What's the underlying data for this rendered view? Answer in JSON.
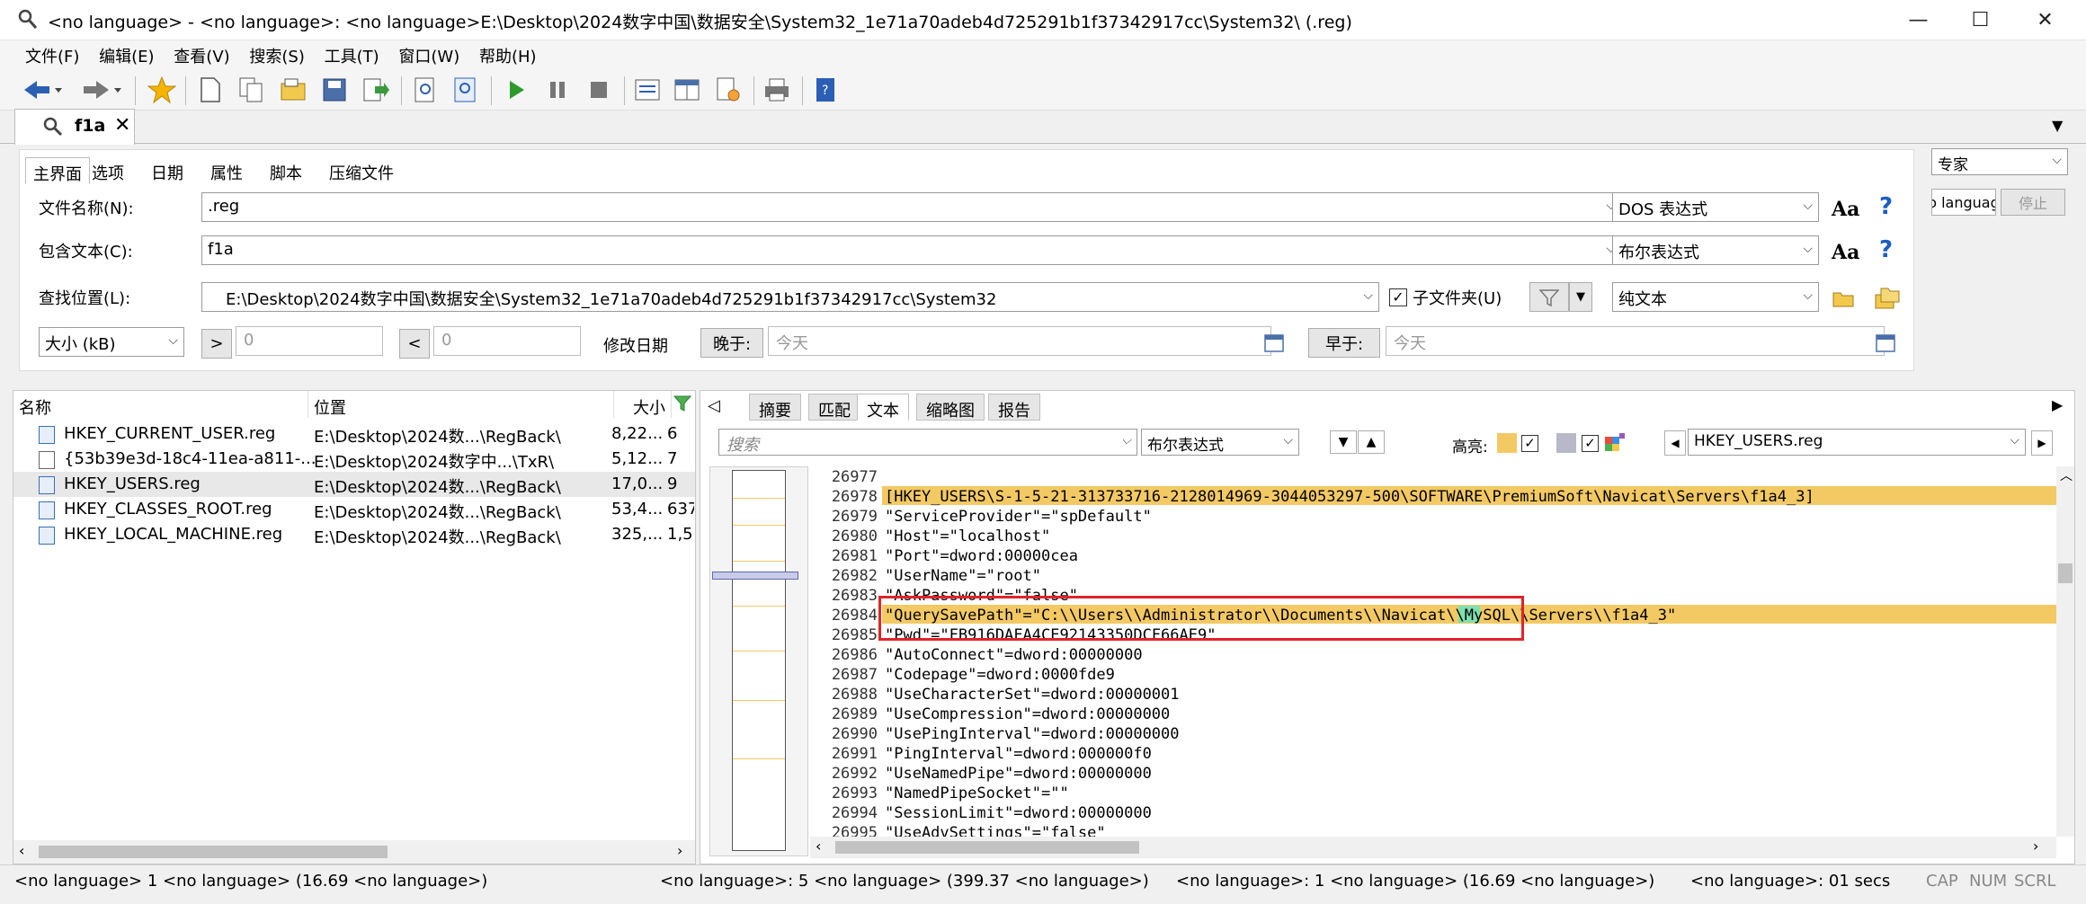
{
  "window": {
    "title": "<no language> - <no language>: <no language>E:\\Desktop\\2024数字中国\\数据安全\\System32_1e71a70adeb4d725291b1f37342917cc\\System32\\ (.reg)"
  },
  "menu": [
    "文件(F)",
    "编辑(E)",
    "查看(V)",
    "搜索(S)",
    "工具(T)",
    "窗口(W)",
    "帮助(H)"
  ],
  "tab": {
    "label": "f1a"
  },
  "panel_tabs": [
    "主界面",
    "选项",
    "日期",
    "属性",
    "脚本",
    "压缩文件"
  ],
  "search": {
    "filename_label": "文件名称(N):",
    "filename_value": ".reg",
    "filename_mode": "DOS 表达式",
    "contains_label": "包含文本(C):",
    "contains_value": "f1a",
    "contains_mode": "布尔表达式",
    "location_label": "查找位置(L):",
    "location_value": "E:\\Desktop\\2024数字中国\\数据安全\\System32_1e71a70adeb4d725291b1f37342917cc\\System32",
    "subfolders_label": "子文件夹(U)",
    "location_mode": "纯文本",
    "size_unit": "大小 (kB)",
    "gt": ">",
    "lt": "<",
    "size_min": "0",
    "size_max": "0",
    "date_label": "修改日期",
    "later_btn": "晚于:",
    "later_value": "今天",
    "earlier_btn": "早于:",
    "earlier_value": "今天"
  },
  "side": {
    "mode": "专家",
    "lang_btn": "o languag",
    "stop_btn": "停止"
  },
  "results": {
    "headers": [
      "名称",
      "位置",
      "大小"
    ],
    "rows": [
      {
        "name": "HKEY_CURRENT_USER.reg",
        "location": "E:\\Desktop\\2024数...\\RegBack\\",
        "size": "8,22...",
        "hits": "6"
      },
      {
        "name": "{53b39e3d-18c4-11ea-a811-...",
        "location": "E:\\Desktop\\2024数字中...\\TxR\\",
        "size": "5,12...",
        "hits": "7"
      },
      {
        "name": "HKEY_USERS.reg",
        "location": "E:\\Desktop\\2024数...\\RegBack\\",
        "size": "17,0...",
        "hits": "9"
      },
      {
        "name": "HKEY_CLASSES_ROOT.reg",
        "location": "E:\\Desktop\\2024数...\\RegBack\\",
        "size": "53,4...",
        "hits": "637"
      },
      {
        "name": "HKEY_LOCAL_MACHINE.reg",
        "location": "E:\\Desktop\\2024数...\\RegBack\\",
        "size": "325,...",
        "hits": "1,5..."
      }
    ]
  },
  "preview": {
    "tabs": [
      "摘要",
      "匹配",
      "文本",
      "缩略图",
      "报告"
    ],
    "search_placeholder": "搜索",
    "mode": "布尔表达式",
    "highlight_label": "高亮:",
    "file": "HKEY_USERS.reg",
    "lines": [
      {
        "n": "26977",
        "t": ""
      },
      {
        "n": "26978",
        "t": "[HKEY_USERS\\S-1-5-21-313733716-2128014969-3044053297-500\\SOFTWARE\\PremiumSoft\\Navicat\\Servers\\f1a4_3]"
      },
      {
        "n": "26979",
        "t": "\"ServiceProvider\"=\"spDefault\""
      },
      {
        "n": "26980",
        "t": "\"Host\"=\"localhost\""
      },
      {
        "n": "26981",
        "t": "\"Port\"=dword:00000cea"
      },
      {
        "n": "26982",
        "t": "\"UserName\"=\"root\""
      },
      {
        "n": "26983",
        "t": "\"AskPassword\"=\"false\""
      },
      {
        "n": "26984",
        "t": "\"QuerySavePath\"=\"C:\\\\Users\\\\Administrator\\\\Documents\\\\Navicat\\\\MySQL\\\\Servers\\\\f1a4_3\""
      },
      {
        "n": "26985",
        "t": "\"Pwd\"=\"FB916DAFA4CE92143350DCF66AE9\""
      },
      {
        "n": "26986",
        "t": "\"AutoConnect\"=dword:00000000"
      },
      {
        "n": "26987",
        "t": "\"Codepage\"=dword:0000fde9"
      },
      {
        "n": "26988",
        "t": "\"UseCharacterSet\"=dword:00000001"
      },
      {
        "n": "26989",
        "t": "\"UseCompression\"=dword:00000000"
      },
      {
        "n": "26990",
        "t": "\"UsePingInterval\"=dword:00000000"
      },
      {
        "n": "26991",
        "t": "\"PingInterval\"=dword:000000f0"
      },
      {
        "n": "26992",
        "t": "\"UseNamedPipe\"=dword:00000000"
      },
      {
        "n": "26993",
        "t": "\"NamedPipeSocket\"=\"\""
      },
      {
        "n": "26994",
        "t": "\"SessionLimit\"=dword:00000000"
      },
      {
        "n": "26995",
        "t": "\"UseAdvSettings\"=\"false\""
      }
    ]
  },
  "status": {
    "s1": "<no language> 1 <no language> (16.69 <no language>)",
    "s2": "<no language>: 5 <no language> (399.37 <no language>)",
    "s3": "<no language>: 1 <no language> (16.69 <no language>)",
    "s4": "<no language>: 01 secs",
    "caps": "CAP",
    "num": "NUM",
    "scrl": "SCRL"
  },
  "colors": {
    "highlight": "#f3c964",
    "match": "#7ee0b0",
    "selection": "#e8e8e8",
    "annotation": "#e0242a"
  }
}
